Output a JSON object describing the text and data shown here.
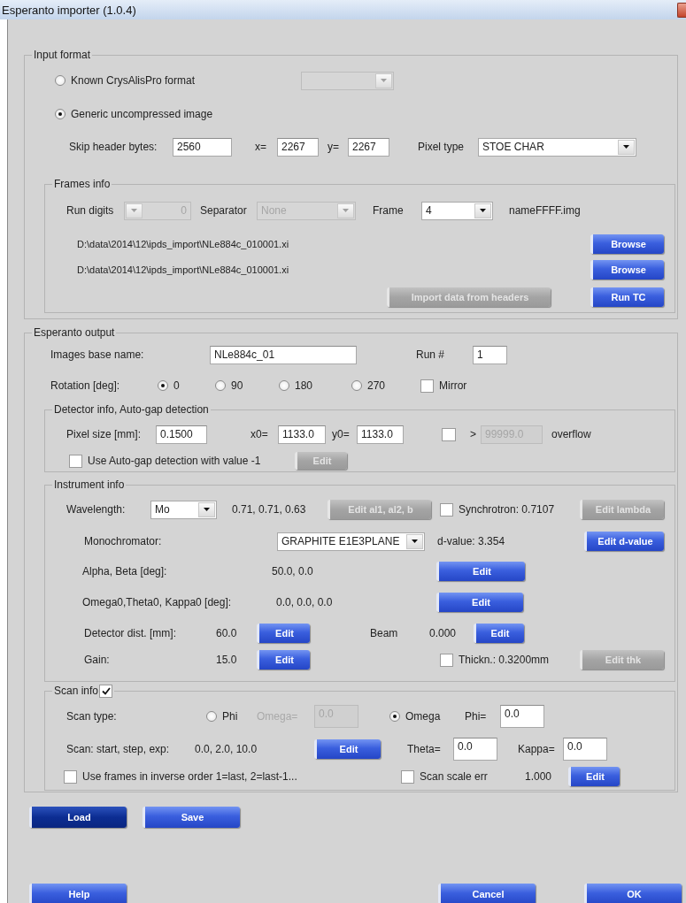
{
  "window": {
    "title": "Esperanto importer (1.0.4)"
  },
  "groups": [
    {
      "title": "Input format",
      "rows": [
        {
          "items": [
            {
              "kind": "radio",
              "label": "Known CrysAlisPro format",
              "selected": false
            },
            {
              "kind": "dropdown",
              "value": "",
              "disabled": true
            }
          ]
        },
        {
          "items": [
            {
              "kind": "radio",
              "label": "Generic uncompressed image",
              "selected": true
            }
          ]
        },
        {
          "items": [
            {
              "kind": "text",
              "text": "Skip header bytes:"
            },
            {
              "kind": "field",
              "value": "2560",
              "disabled": false
            },
            {
              "kind": "text",
              "text": "x="
            },
            {
              "kind": "field",
              "value": "2267",
              "disabled": false
            },
            {
              "kind": "text",
              "text": "y="
            },
            {
              "kind": "field",
              "value": "2267",
              "disabled": false
            },
            {
              "kind": "text",
              "text": "Pixel type"
            },
            {
              "kind": "dropdown",
              "value": "STOE CHAR",
              "disabled": false
            }
          ]
        }
      ],
      "subgroups": [
        {
          "title": "Frames info",
          "rows": [
            {
              "items": [
                {
                  "kind": "text",
                  "text": "Run digits"
                },
                {
                  "kind": "spinbox",
                  "value": "0",
                  "disabled": true
                },
                {
                  "kind": "text",
                  "text": "Separator"
                },
                {
                  "kind": "dropdown",
                  "value": "None",
                  "disabled": true
                },
                {
                  "kind": "text",
                  "text": "Frame"
                },
                {
                  "kind": "dropdown",
                  "value": "4",
                  "disabled": false
                },
                {
                  "kind": "text",
                  "text": "nameFFFF.img"
                }
              ]
            },
            {
              "items": [
                {
                  "kind": "text",
                  "text": "D:\\data\\2014\\12\\ipds_import\\NLe884c_010001.xi"
                },
                {
                  "kind": "button",
                  "label": "Browse",
                  "disabled": false
                }
              ]
            },
            {
              "items": [
                {
                  "kind": "text",
                  "text": "D:\\data\\2014\\12\\ipds_import\\NLe884c_010001.xi"
                },
                {
                  "kind": "button",
                  "label": "Browse",
                  "disabled": false
                }
              ]
            },
            {
              "items": [
                {
                  "kind": "button",
                  "label": "Import data from headers",
                  "disabled": true
                },
                {
                  "kind": "button",
                  "label": "Run TC",
                  "disabled": false
                }
              ]
            }
          ]
        }
      ]
    },
    {
      "title": "Esperanto output",
      "rows": [
        {
          "items": [
            {
              "kind": "text",
              "text": "Images base name:"
            },
            {
              "kind": "field",
              "value": "NLe884c_01",
              "disabled": false
            },
            {
              "kind": "text",
              "text": "Run #"
            },
            {
              "kind": "field",
              "value": "1",
              "disabled": false
            }
          ]
        },
        {
          "items": [
            {
              "kind": "text",
              "text": "Rotation [deg]:"
            },
            {
              "kind": "radio",
              "label": "0",
              "selected": true
            },
            {
              "kind": "radio",
              "label": "90",
              "selected": false
            },
            {
              "kind": "radio",
              "label": "180",
              "selected": false
            },
            {
              "kind": "radio",
              "label": "270",
              "selected": false
            },
            {
              "kind": "checkbox",
              "label": "Mirror",
              "checked": false
            }
          ]
        }
      ],
      "subgroups": [
        {
          "title": "Detector info, Auto-gap detection",
          "rows": [
            {
              "items": [
                {
                  "kind": "text",
                  "text": "Pixel size [mm]:"
                },
                {
                  "kind": "field",
                  "value": "0.1500",
                  "disabled": false
                },
                {
                  "kind": "text",
                  "text": "x0="
                },
                {
                  "kind": "field",
                  "value": "1133.0",
                  "disabled": false
                },
                {
                  "kind": "text",
                  "text": "y0="
                },
                {
                  "kind": "field",
                  "value": "1133.0",
                  "disabled": false
                },
                {
                  "kind": "checkbox",
                  "checked": false
                },
                {
                  "kind": "text",
                  "text": ">"
                },
                {
                  "kind": "field",
                  "value": "99999.0",
                  "disabled": true
                },
                {
                  "kind": "text",
                  "text": "overflow"
                }
              ]
            },
            {
              "items": [
                {
                  "kind": "checkbox",
                  "label": "Use Auto-gap detection with value -1",
                  "checked": false
                },
                {
                  "kind": "button",
                  "label": "Edit",
                  "disabled": true
                }
              ]
            }
          ]
        },
        {
          "title": "Instrument info",
          "rows": [
            {
              "items": [
                {
                  "kind": "text",
                  "text": "Wavelength:"
                },
                {
                  "kind": "dropdown",
                  "value": "Mo",
                  "disabled": false
                },
                {
                  "kind": "text",
                  "text": "0.71, 0.71, 0.63"
                },
                {
                  "kind": "button",
                  "label": "Edit al1, al2, b",
                  "disabled": true
                },
                {
                  "kind": "checkbox",
                  "label": "Synchrotron: 0.7107",
                  "checked": false
                },
                {
                  "kind": "button",
                  "label": "Edit lambda",
                  "disabled": true
                }
              ]
            },
            {
              "items": [
                {
                  "kind": "text",
                  "text": "Monochromator:"
                },
                {
                  "kind": "dropdown",
                  "value": "GRAPHITE E1E3PLANE",
                  "disabled": false
                },
                {
                  "kind": "text",
                  "text": "d-value: 3.354"
                },
                {
                  "kind": "button",
                  "label": "Edit d-value",
                  "disabled": false
                }
              ]
            },
            {
              "items": [
                {
                  "kind": "text",
                  "text": "Alpha, Beta [deg]:"
                },
                {
                  "kind": "text",
                  "text": "50.0, 0.0"
                },
                {
                  "kind": "button",
                  "label": "Edit",
                  "disabled": false
                }
              ]
            },
            {
              "items": [
                {
                  "kind": "text",
                  "text": "Omega0,Theta0, Kappa0 [deg]:"
                },
                {
                  "kind": "text",
                  "text": "0.0, 0.0, 0.0"
                },
                {
                  "kind": "button",
                  "label": "Edit",
                  "disabled": false
                }
              ]
            },
            {
              "items": [
                {
                  "kind": "text",
                  "text": "Detector dist. [mm]:"
                },
                {
                  "kind": "text",
                  "text": "60.0"
                },
                {
                  "kind": "button",
                  "label": "Edit",
                  "disabled": false
                },
                {
                  "kind": "text",
                  "text": "Beam"
                },
                {
                  "kind": "text",
                  "text": "0.000"
                },
                {
                  "kind": "button",
                  "label": "Edit",
                  "disabled": false
                }
              ]
            },
            {
              "items": [
                {
                  "kind": "text",
                  "text": "Gain:"
                },
                {
                  "kind": "text",
                  "text": "15.0"
                },
                {
                  "kind": "button",
                  "label": "Edit",
                  "disabled": false
                },
                {
                  "kind": "checkbox",
                  "label": "Thickn.: 0.3200mm",
                  "checked": false
                },
                {
                  "kind": "button",
                  "label": "Edit thk",
                  "disabled": true
                }
              ]
            }
          ]
        },
        {
          "title": "Scan info",
          "checked": true,
          "rows": [
            {
              "items": [
                {
                  "kind": "text",
                  "text": "Scan type:"
                },
                {
                  "kind": "radio",
                  "label": "Phi",
                  "selected": false
                },
                {
                  "kind": "text",
                  "text": "Omega=",
                  "disabled": true
                },
                {
                  "kind": "field",
                  "value": "0.0",
                  "disabled": true
                },
                {
                  "kind": "radio",
                  "label": "Omega",
                  "selected": true
                },
                {
                  "kind": "text",
                  "text": "Phi="
                },
                {
                  "kind": "field",
                  "value": "0.0",
                  "disabled": false
                }
              ]
            },
            {
              "items": [
                {
                  "kind": "text",
                  "text": "Scan: start, step, exp:"
                },
                {
                  "kind": "text",
                  "text": "0.0, 2.0, 10.0"
                },
                {
                  "kind": "button",
                  "label": "Edit",
                  "disabled": false
                },
                {
                  "kind": "text",
                  "text": "Theta="
                },
                {
                  "kind": "field",
                  "value": "0.0",
                  "disabled": false
                },
                {
                  "kind": "text",
                  "text": "Kappa="
                },
                {
                  "kind": "field",
                  "value": "0.0",
                  "disabled": false
                }
              ]
            },
            {
              "items": [
                {
                  "kind": "checkbox",
                  "label": "Use frames in inverse order 1=last, 2=last-1...",
                  "checked": false
                },
                {
                  "kind": "checkbox",
                  "label": "Scan scale err",
                  "checked": false
                },
                {
                  "kind": "text",
                  "text": "1.000"
                },
                {
                  "kind": "button",
                  "label": "Edit",
                  "disabled": false
                }
              ]
            }
          ]
        }
      ]
    }
  ],
  "buttons": [
    {
      "label": "Load",
      "focused": true
    },
    {
      "label": "Save",
      "focused": false
    }
  ],
  "footer_buttons": [
    {
      "label": "Help"
    },
    {
      "label": "Cancel"
    },
    {
      "label": "OK"
    }
  ]
}
